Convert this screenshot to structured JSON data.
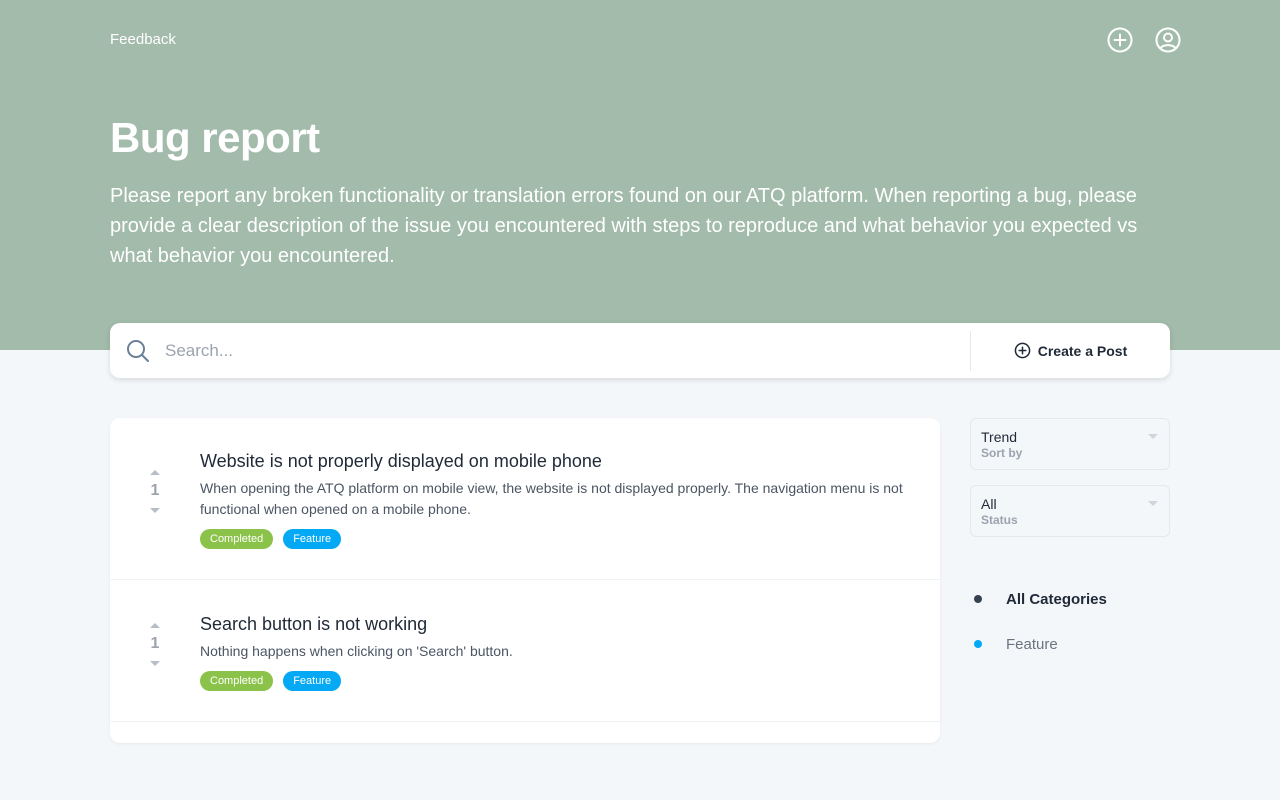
{
  "header": {
    "brand": "Feedback",
    "icons": [
      "add-circle-icon",
      "user-account-icon"
    ]
  },
  "hero": {
    "title": "Bug report",
    "description": "Please report any broken functionality or translation errors found on our ATQ platform. When reporting a bug, please provide a clear description of the issue you encountered with steps to reproduce and what behavior you expected vs what behavior you encountered."
  },
  "search": {
    "placeholder": "Search...",
    "create_label": "Create a Post"
  },
  "posts": [
    {
      "votes": "1",
      "title": "Website is not properly displayed on mobile phone",
      "description": "When opening the ATQ platform on mobile view, the website is not displayed properly. The navigation menu is not functional when opened on a mobile phone.",
      "status": "Completed",
      "category": "Feature"
    },
    {
      "votes": "1",
      "title": "Search button is not working",
      "description": "Nothing happens when clicking on 'Search' button.",
      "status": "Completed",
      "category": "Feature"
    }
  ],
  "filters": {
    "sort": {
      "value": "Trend",
      "label": "Sort by"
    },
    "status": {
      "value": "All",
      "label": "Status"
    }
  },
  "categories": [
    {
      "label": "All Categories",
      "color": "#374151"
    },
    {
      "label": "Feature",
      "color": "#03a9f4"
    }
  ],
  "colors": {
    "hero_bg": "#a2bbab",
    "page_bg": "#f4f7fa",
    "completed": "#8bc34a",
    "feature": "#03a9f4"
  }
}
